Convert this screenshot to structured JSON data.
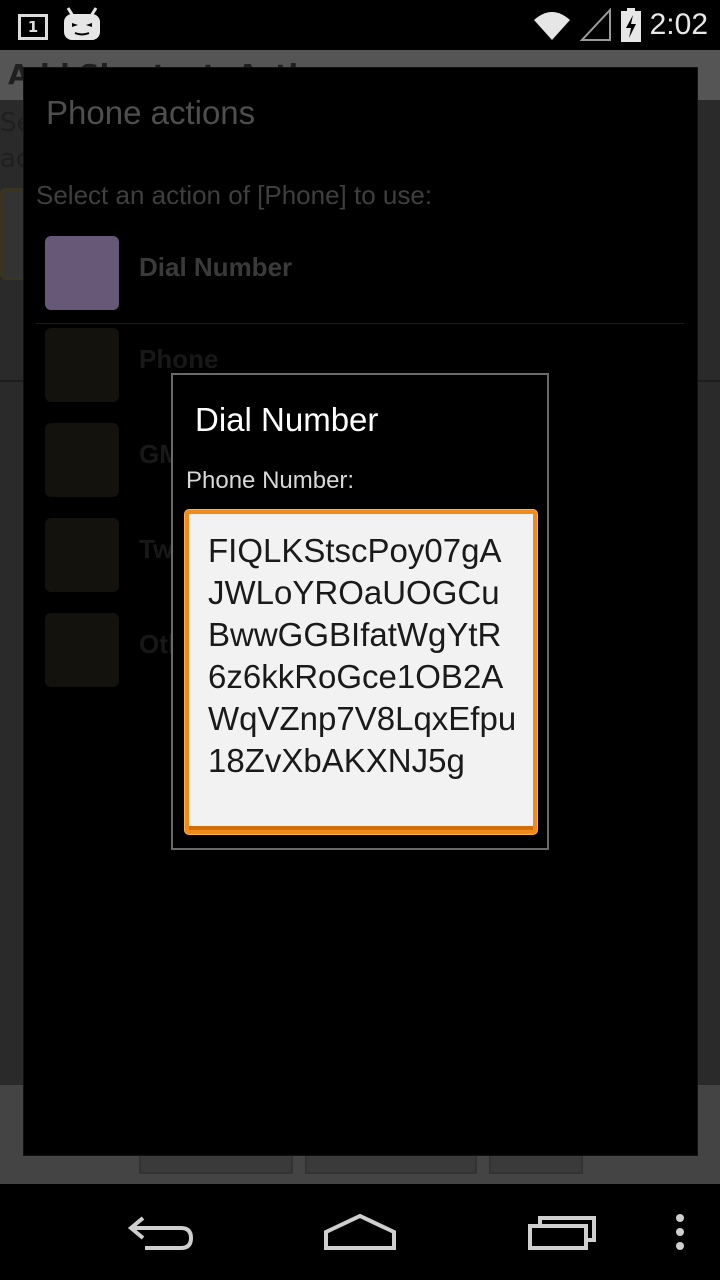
{
  "status_bar": {
    "notification_count": "1",
    "time": "2:02",
    "icons": [
      "notification-box-icon",
      "android-robot-icon",
      "wifi-icon",
      "signal-icon",
      "battery-charging-icon"
    ]
  },
  "background": {
    "title": "Add Shortcut: Action",
    "subtitle_lines": [
      "Se",
      "ac"
    ]
  },
  "phone_actions_dialog": {
    "title": "Phone actions",
    "prompt": "Select an action of [Phone] to use:",
    "items": [
      {
        "label": "Dial Number",
        "color": "#685877"
      },
      {
        "label": "Phone",
        "color": "#14120c"
      },
      {
        "label": "GMail",
        "color": "#14120c"
      },
      {
        "label": "Twitter",
        "color": "#14120c"
      },
      {
        "label": "Other",
        "color": "#14120c"
      }
    ]
  },
  "dial_dialog": {
    "title": "Dial Number",
    "field_label": "Phone Number:",
    "field_value": "FIQLKStscPoy07gAJWLoYROaUOGCuBwwGGBIfatWgYtR6z6kkRoGce1OB2AWqVZnp7V8LqxEfpu18ZvXbAKXNJ5g"
  },
  "nav_bar": {
    "buttons": [
      "back-icon",
      "home-icon",
      "recents-icon",
      "menu-icon"
    ]
  },
  "colors": {
    "accent": "#f08a1c",
    "input_bg": "#f2f2f2",
    "dialog_border": "#6a6a6a"
  }
}
